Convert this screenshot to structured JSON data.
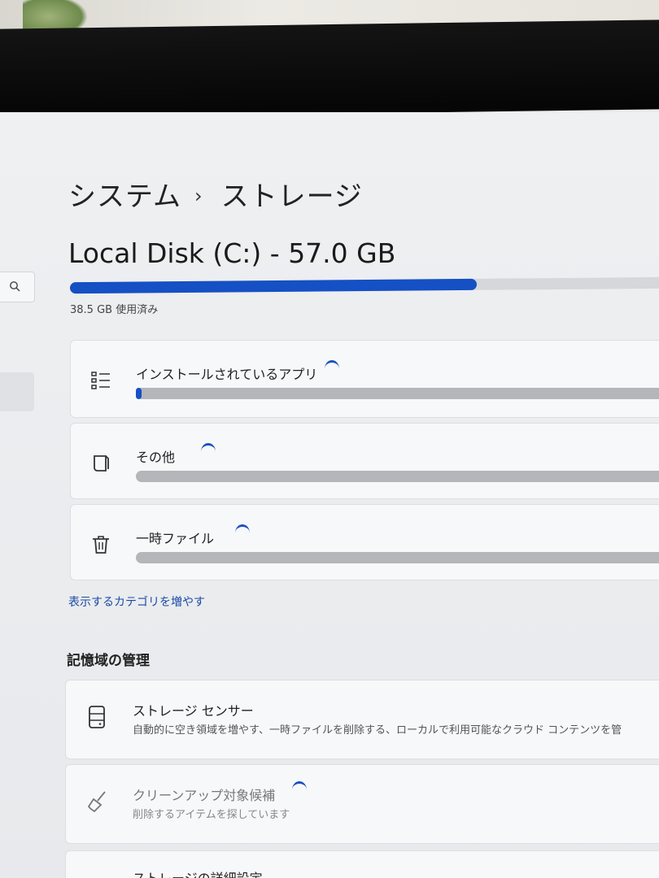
{
  "breadcrumb": {
    "parent": "システム",
    "separator": "›",
    "current": "ストレージ"
  },
  "disk": {
    "title": "Local Disk (C:) - 57.0 GB",
    "used_text": "38.5 GB 使用済み",
    "used_fraction": 0.675
  },
  "categories": [
    {
      "label": "インストールされているアプリ",
      "icon": "app-list-icon",
      "fill_fraction": 0.01
    },
    {
      "label": "その他",
      "icon": "document-icon",
      "fill_fraction": 0
    },
    {
      "label": "一時ファイル",
      "icon": "trash-icon",
      "fill_fraction": 0
    }
  ],
  "more_categories_link": "表示するカテゴリを増やす",
  "storage_management": {
    "title": "記憶域の管理",
    "items": [
      {
        "title": "ストレージ センサー",
        "subtitle": "自動的に空き領域を増やす、一時ファイルを削除する、ローカルで利用可能なクラウド コンテンツを管",
        "icon": "storage-drive-icon"
      },
      {
        "title": "クリーンアップ対象候補",
        "subtitle": "削除するアイテムを探しています",
        "icon": "broom-icon"
      },
      {
        "title": "ストレージの詳細設定",
        "subtitle": "",
        "icon": "chevron-icon"
      }
    ]
  },
  "colors": {
    "accent": "#1550c4",
    "track": "#b4b6b9"
  }
}
